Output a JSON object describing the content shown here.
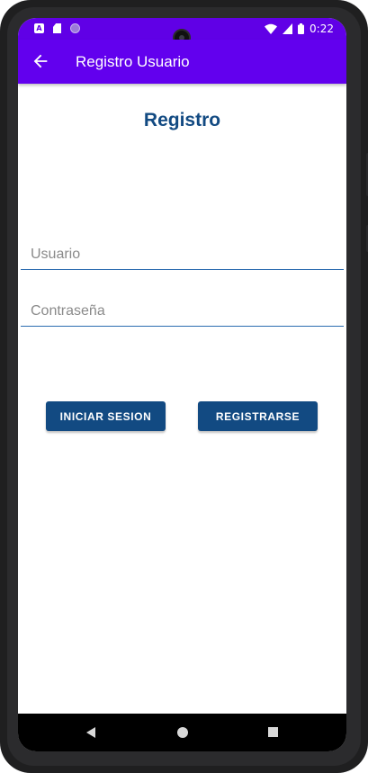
{
  "status_bar": {
    "time": "0:22",
    "icons": [
      "a-notification-icon",
      "sd-card-icon",
      "circle-notification-icon",
      "wifi-icon",
      "signal-icon",
      "battery-icon"
    ]
  },
  "app_bar": {
    "title": "Registro Usuario",
    "back_icon": "arrow-back-icon",
    "color": "#6200ee"
  },
  "form": {
    "heading": "Registro",
    "username_placeholder": "Usuario",
    "username_value": "",
    "password_placeholder": "Contraseña",
    "password_value": ""
  },
  "buttons": {
    "login_label": "INICIAR SESION",
    "register_label": "REGISTRARSE",
    "color": "#124a82"
  },
  "nav_bar": {
    "icons": [
      "back-triangle-icon",
      "home-circle-icon",
      "recents-square-icon"
    ]
  }
}
